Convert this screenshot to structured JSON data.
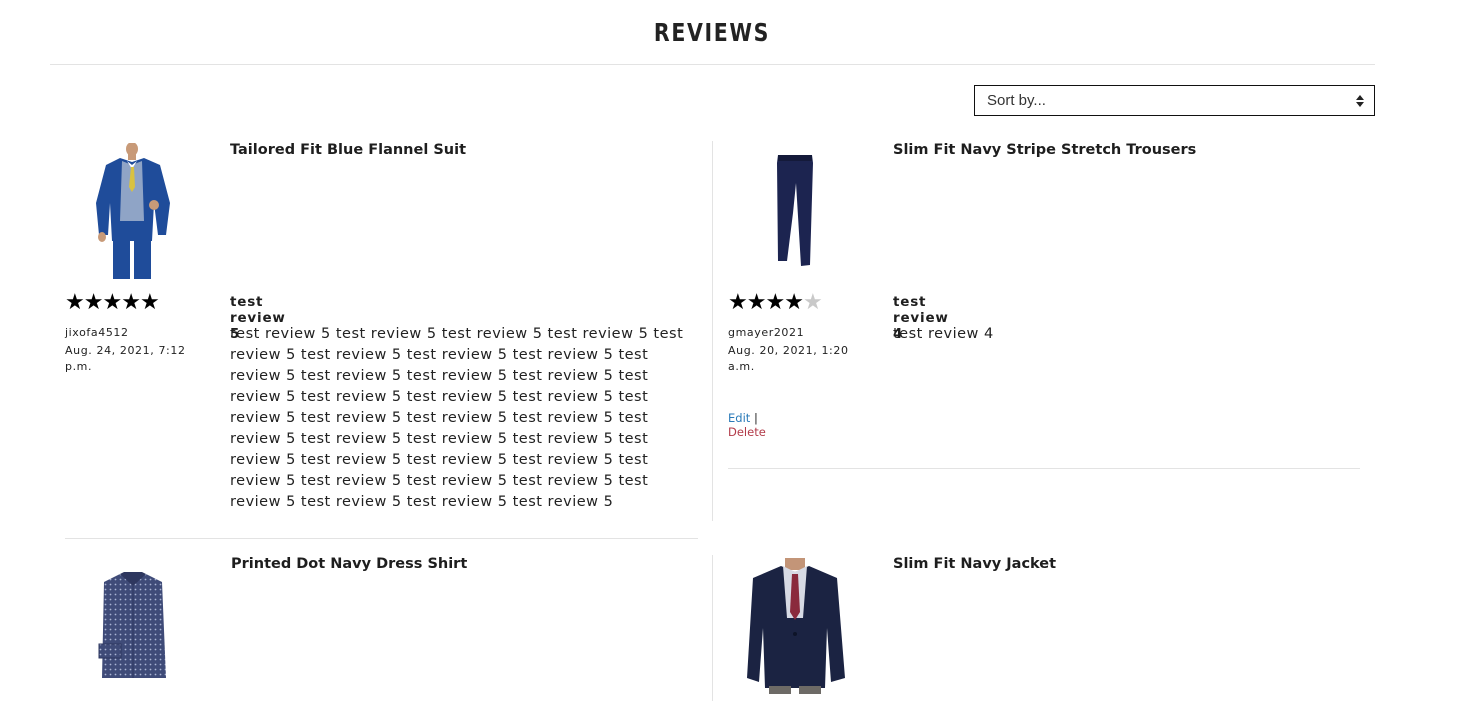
{
  "page": {
    "title": "REVIEWS"
  },
  "sort": {
    "selected": "Sort by..."
  },
  "reviews": [
    {
      "product": "Tailored Fit Blue Flannel Suit",
      "rating": 5,
      "author": "jixofa4512",
      "date": "Aug. 24, 2021, 7:12 p.m.",
      "title": "test review 5",
      "body": "test review 5 test review 5 test review 5 test review 5 test review 5 test review 5 test review 5 test review 5 test review 5 test review 5 test review 5 test review 5 test review 5 test review 5 test review 5 test review 5 test review 5 test review 5 test review 5 test review 5 test review 5 test review 5 test review 5 test review 5 test review 5 test review 5 test review 5 test review 5 test review 5 test review 5 test review 5 test review 5 test review 5 test review 5 test review 5 test review 5"
    },
    {
      "product": "Slim Fit Navy Stripe Stretch Trousers",
      "rating": 4,
      "author": "gmayer2021",
      "date": "Aug. 20, 2021, 1:20 a.m.",
      "title": "test review 4",
      "body": "test review 4",
      "edit_label": "Edit",
      "separator": "|",
      "delete_label": "Delete"
    },
    {
      "product": "Printed Dot Navy Dress Shirt"
    },
    {
      "product": "Slim Fit Navy Jacket"
    }
  ],
  "colors": {
    "edit": "#2a7ab8",
    "delete": "#b23a48",
    "star_on": "#000000",
    "star_off": "#c9c9c9"
  }
}
